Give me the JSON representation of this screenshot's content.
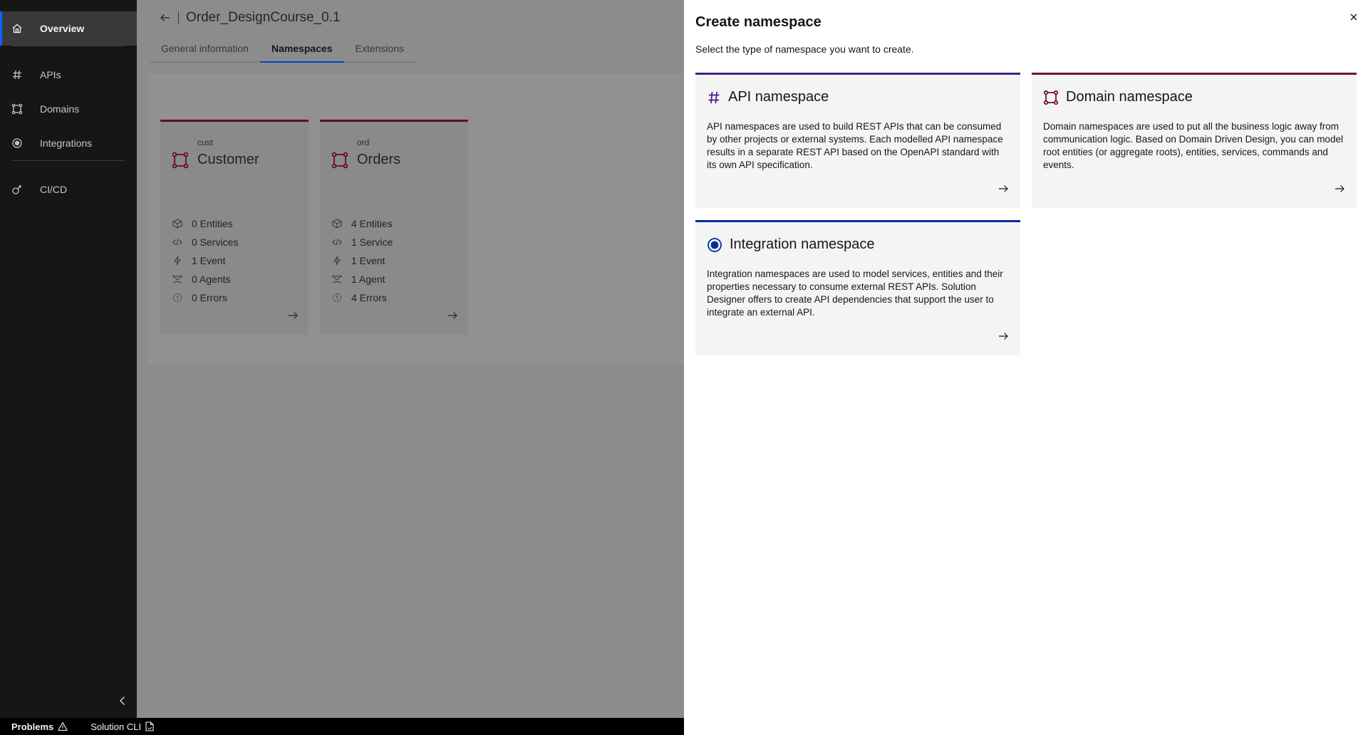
{
  "sidebar": {
    "items": [
      {
        "label": "Overview",
        "icon": "home-icon"
      },
      {
        "label": "APIs",
        "icon": "hash-icon"
      },
      {
        "label": "Domains",
        "icon": "domain-icon"
      },
      {
        "label": "Integrations",
        "icon": "integration-icon"
      },
      {
        "label": "CI/CD",
        "icon": "cicd-icon"
      }
    ]
  },
  "statusbar": {
    "problems": "Problems",
    "cli": "Solution CLI"
  },
  "header": {
    "title": "Order_DesignCourse_0.1"
  },
  "tabs": [
    {
      "label": "General information"
    },
    {
      "label": "Namespaces"
    },
    {
      "label": "Extensions"
    }
  ],
  "namespaces": [
    {
      "prefix": "cust",
      "name": "Customer",
      "stats": {
        "entities": "0 Entities",
        "services": "0 Services",
        "events": "1 Event",
        "agents": "0 Agents",
        "errors": "0 Errors"
      }
    },
    {
      "prefix": "ord",
      "name": "Orders",
      "stats": {
        "entities": "4 Entities",
        "services": "1 Service",
        "events": "1 Event",
        "agents": "1 Agent",
        "errors": "4 Errors"
      }
    }
  ],
  "panel": {
    "title": "Create namespace",
    "description": "Select the type of namespace you want to create.",
    "cards": {
      "api": {
        "title": "API namespace",
        "description": "API namespaces are used to build REST APIs that can be consumed by other projects or external systems. Each modelled API namespace results in a separate REST API based on the OpenAPI standard with its own API specification."
      },
      "domain": {
        "title": "Domain namespace",
        "description": "Domain namespaces are used to put all the business logic away from communication logic. Based on Domain Driven Design, you can model root entities (or aggregate roots), entities, services, commands and events."
      },
      "integration": {
        "title": "Integration namespace",
        "description": "Integration namespaces are used to model services, entities and their properties necessary to consume external REST APIs. Solution Designer offers to create API dependencies that support the user to integrate an external API."
      }
    }
  },
  "colors": {
    "api_accent": "#491d8b",
    "domain_accent": "#750e3d",
    "integration_accent": "#002d9c",
    "active_tab": "#0043ce"
  }
}
